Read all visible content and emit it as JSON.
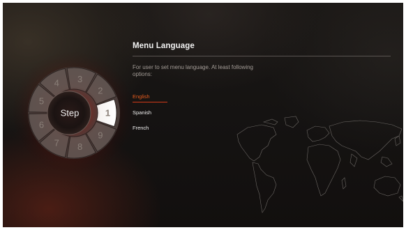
{
  "menu": {
    "title": "Menu Language",
    "description": "For user to set menu language. At least following options:",
    "options": [
      "English",
      "Spanish",
      "French"
    ],
    "selected_index": 0
  },
  "dial": {
    "center_label": "Step",
    "active_step": "1",
    "steps": [
      "1",
      "2",
      "3",
      "4",
      "5",
      "6",
      "7",
      "8",
      "9"
    ]
  },
  "colors": {
    "accent": "#e65c1e",
    "active_step_red": "#d41414",
    "text": "#eeeeee"
  }
}
